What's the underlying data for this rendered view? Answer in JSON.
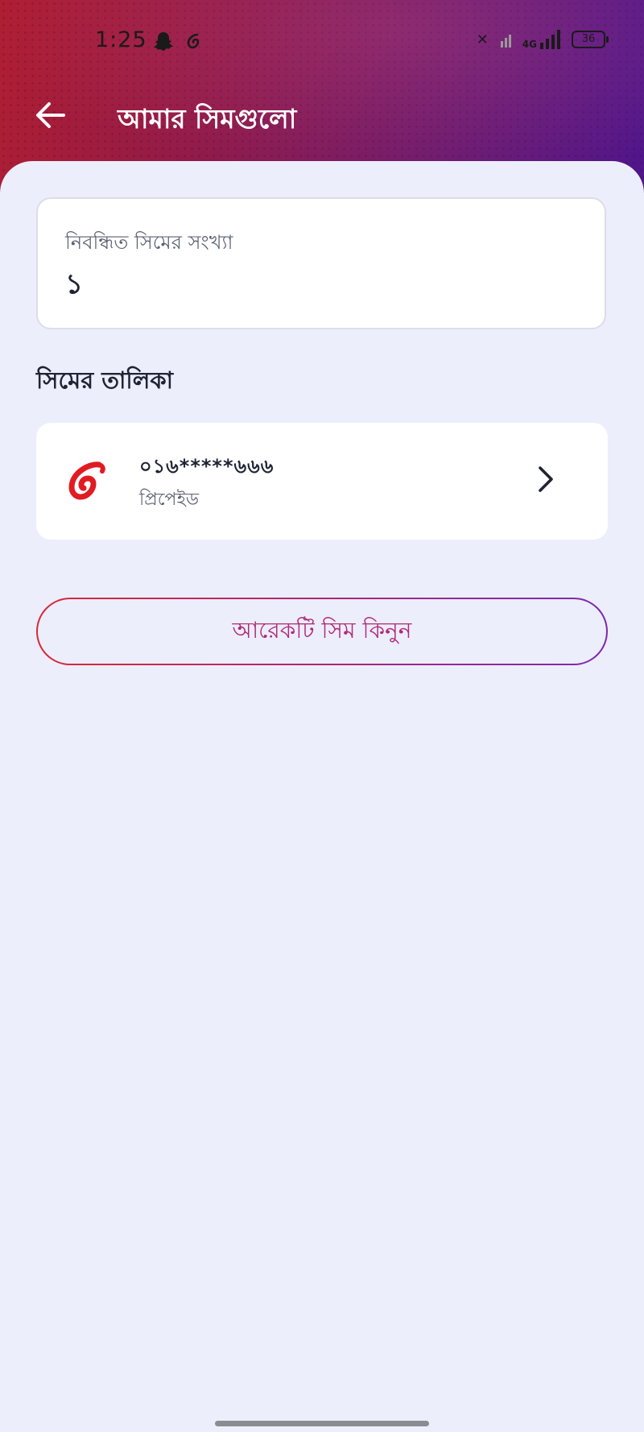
{
  "status_bar": {
    "time": "1:25",
    "network_type": "4G",
    "battery": "36"
  },
  "app_bar": {
    "title": "আমার সিমগুলো"
  },
  "summary": {
    "label": "নিবন্ধিত সিমের সংখ্যা",
    "value": "১"
  },
  "sim_list": {
    "title": "সিমের তালিকা",
    "items": [
      {
        "number": "০১৬*****৬৬৬",
        "type": "প্রিপেইড",
        "operator_icon": "airtel-logo-icon"
      }
    ]
  },
  "buy_sim": {
    "label": "আরেকটি সিম কিনুন"
  },
  "colors": {
    "header_start": "#b01e32",
    "header_end": "#4f168c",
    "accent": "#b0287a",
    "background": "#eceefb",
    "operator_red": "#e11b22"
  }
}
